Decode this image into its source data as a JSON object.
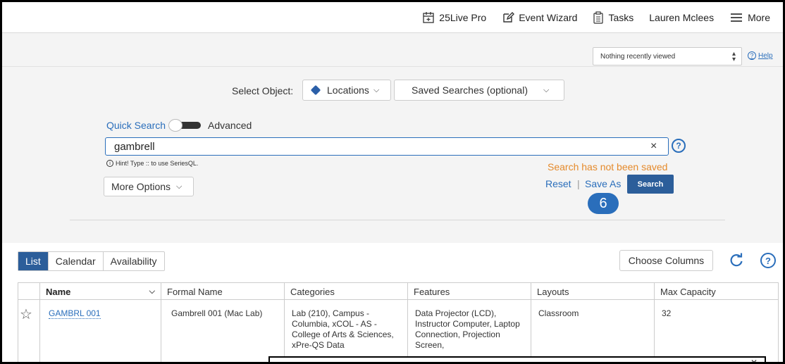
{
  "nav": {
    "items": [
      {
        "label": "25Live Pro",
        "icon": "calendar-plus-icon"
      },
      {
        "label": "Event Wizard",
        "icon": "edit-icon"
      },
      {
        "label": "Tasks",
        "icon": "tasks-icon"
      },
      {
        "label": "Lauren Mclees",
        "icon": ""
      },
      {
        "label": "More",
        "icon": "menu-icon"
      }
    ]
  },
  "subbar": {
    "recent_selected": "Nothing recently viewed",
    "help_label": "Help"
  },
  "search": {
    "select_object_label": "Select Object:",
    "object_value": "Locations",
    "saved_searches_value": "Saved Searches (optional)",
    "quick_search_label": "Quick Search",
    "advanced_label": "Advanced",
    "query_value": "gambrell",
    "clear_glyph": "×",
    "help_glyph": "?",
    "hint_text": "Hint! Type :: to use SeriesQL.",
    "not_saved_text": "Search has not been saved",
    "more_options_label": "More Options",
    "reset_label": "Reset",
    "separator": "|",
    "save_as_label": "Save As",
    "search_button_label": "Search",
    "step_badge": "6"
  },
  "results": {
    "view_tabs": [
      {
        "label": "List",
        "active": true
      },
      {
        "label": "Calendar",
        "active": false
      },
      {
        "label": "Availability",
        "active": false
      }
    ],
    "choose_columns_label": "Choose Columns",
    "columns": [
      "Name",
      "Formal Name",
      "Categories",
      "Features",
      "Layouts",
      "Max Capacity"
    ],
    "rows": [
      {
        "name": "GAMBRL 001",
        "formal_name": "Gambrell 001 (Mac Lab)",
        "categories": "Lab (210), Campus - Columbia, xCOL - AS - College of Arts & Sciences, xPre-QS Data",
        "features": "Data Projector (LCD), Instructor Computer, Laptop Connection, Projection Screen,",
        "layouts": "Classroom",
        "max_capacity": "32"
      }
    ]
  },
  "colors": {
    "link": "#2a6ebb",
    "primary_button": "#2c5e9a",
    "warning": "#e58a2b",
    "panel_bg": "#f4f4f4"
  }
}
